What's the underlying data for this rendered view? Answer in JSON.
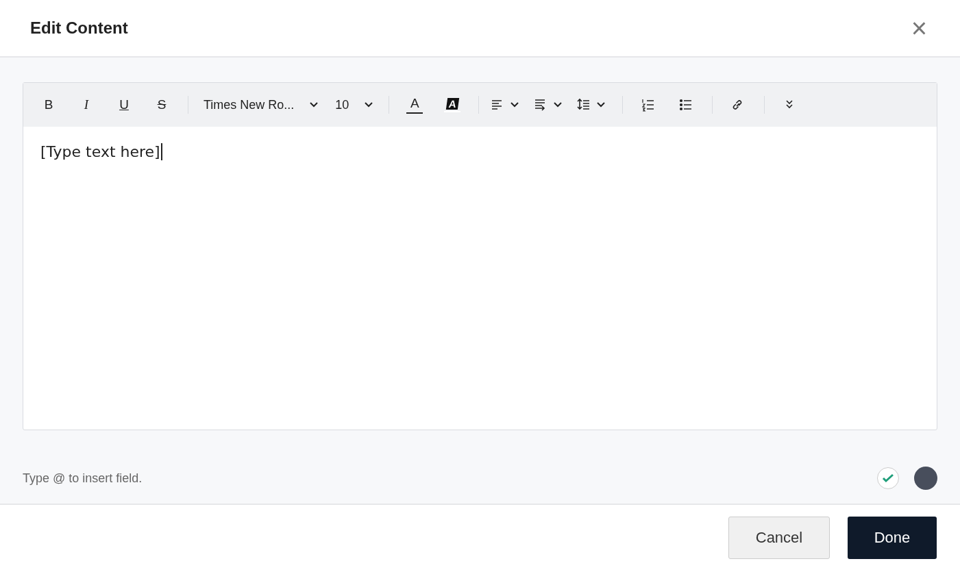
{
  "dialog": {
    "title": "Edit Content",
    "close": "×"
  },
  "toolbar": {
    "format_buttons": [
      {
        "kind": "bold",
        "label": "B"
      },
      {
        "kind": "italic",
        "label": "I"
      },
      {
        "kind": "underline",
        "label": "U"
      },
      {
        "kind": "strike",
        "label": "S"
      }
    ],
    "font_family": "Times New Ro...",
    "font_size": "10",
    "color_buttons": [
      {
        "kind": "text-color",
        "label": "A"
      },
      {
        "kind": "highlight",
        "label": "A"
      }
    ],
    "tools": [
      {
        "kind": "align",
        "dropdown": true
      },
      {
        "kind": "wrap",
        "dropdown": true
      },
      {
        "kind": "line-height",
        "dropdown": true
      },
      {
        "kind": "sep"
      },
      {
        "kind": "ordered-list",
        "dropdown": false
      },
      {
        "kind": "bullet-list",
        "dropdown": false
      },
      {
        "kind": "sep"
      },
      {
        "kind": "link",
        "dropdown": false
      },
      {
        "kind": "sep"
      },
      {
        "kind": "more",
        "dropdown": false
      }
    ]
  },
  "editor": {
    "value": "[Type text here]"
  },
  "hint": "Type @ to insert field.",
  "status": [
    {
      "kind": "check",
      "checked": true
    },
    {
      "kind": "avatar",
      "color": "#484e5c"
    }
  ],
  "buttons": [
    {
      "kind": "secondary",
      "label": "Cancel"
    },
    {
      "kind": "primary",
      "label": "Done"
    }
  ]
}
